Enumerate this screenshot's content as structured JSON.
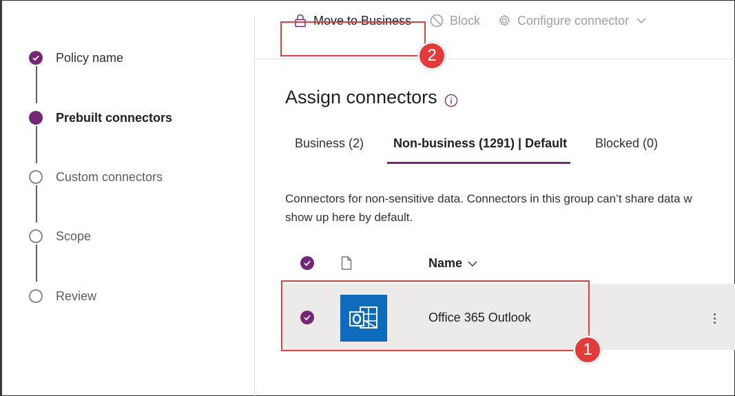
{
  "steps": [
    {
      "label": "Policy name",
      "state": "done"
    },
    {
      "label": "Prebuilt connectors",
      "state": "current"
    },
    {
      "label": "Custom connectors",
      "state": "todo"
    },
    {
      "label": "Scope",
      "state": "todo"
    },
    {
      "label": "Review",
      "state": "todo"
    }
  ],
  "toolbar": {
    "move_label": "Move to Business",
    "block_label": "Block",
    "configure_label": "Configure connector"
  },
  "main": {
    "title": "Assign connectors",
    "tabs": [
      {
        "label": "Business (2)",
        "selected": false
      },
      {
        "label": "Non-business (1291) | Default",
        "selected": true
      },
      {
        "label": "Blocked (0)",
        "selected": false
      }
    ],
    "description_line1": "Connectors for non-sensitive data. Connectors in this group can’t share data w",
    "description_line2": "show up here by default.",
    "table": {
      "name_header": "Name",
      "rows": [
        {
          "name": "Office 365 Outlook",
          "selected": true
        }
      ]
    }
  },
  "callouts": {
    "one": "1",
    "two": "2"
  },
  "colors": {
    "accent": "#742774",
    "highlight": "#e04040",
    "outlook_blue": "#0f6cbd"
  }
}
